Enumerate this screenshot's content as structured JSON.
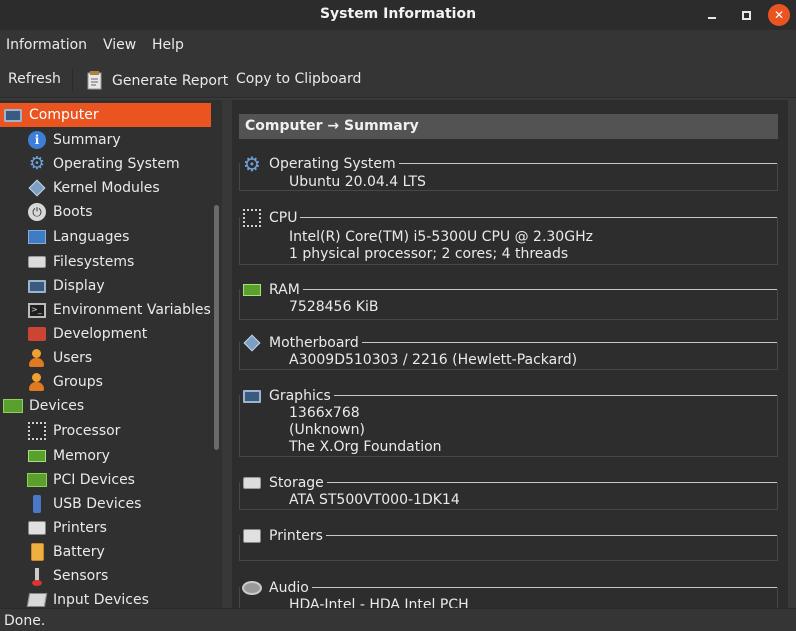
{
  "window": {
    "title": "System Information"
  },
  "menu": {
    "items": [
      "Information",
      "View",
      "Help"
    ]
  },
  "toolbar": {
    "refresh": "Refresh",
    "generate_report": "Generate Report",
    "copy": "Copy to Clipboard"
  },
  "sidebar": {
    "items": [
      {
        "label": "Computer",
        "icon": "monitor-icon"
      },
      {
        "label": "Summary",
        "icon": "info-icon"
      },
      {
        "label": "Operating System",
        "icon": "gear-icon"
      },
      {
        "label": "Kernel Modules",
        "icon": "module-icon"
      },
      {
        "label": "Boots",
        "icon": "power-icon"
      },
      {
        "label": "Languages",
        "icon": "flag-icon"
      },
      {
        "label": "Filesystems",
        "icon": "disk-icon"
      },
      {
        "label": "Display",
        "icon": "display-icon"
      },
      {
        "label": "Environment Variables",
        "icon": "terminal-icon"
      },
      {
        "label": "Development",
        "icon": "development-icon"
      },
      {
        "label": "Users",
        "icon": "user-icon"
      },
      {
        "label": "Groups",
        "icon": "group-icon"
      },
      {
        "label": "Devices",
        "icon": "chip-icon"
      },
      {
        "label": "Processor",
        "icon": "cpu-icon"
      },
      {
        "label": "Memory",
        "icon": "ram-icon"
      },
      {
        "label": "PCI Devices",
        "icon": "pci-icon"
      },
      {
        "label": "USB Devices",
        "icon": "usb-icon"
      },
      {
        "label": "Printers",
        "icon": "printer-icon"
      },
      {
        "label": "Battery",
        "icon": "battery-icon"
      },
      {
        "label": "Sensors",
        "icon": "sensor-icon"
      },
      {
        "label": "Input Devices",
        "icon": "input-device-icon"
      }
    ]
  },
  "content": {
    "header": "Computer → Summary",
    "sections": [
      {
        "title": "Operating System",
        "values": [
          "Ubuntu 20.04.4 LTS"
        ]
      },
      {
        "title": "CPU",
        "values": [
          "Intel(R) Core(TM) i5-5300U CPU @ 2.30GHz",
          "1 physical processor; 2 cores; 4 threads"
        ]
      },
      {
        "title": "RAM",
        "values": [
          "7528456 KiB"
        ]
      },
      {
        "title": "Motherboard",
        "values": [
          "A3009D510303 / 2216 (Hewlett-Packard)"
        ]
      },
      {
        "title": "Graphics",
        "values": [
          "1366x768",
          "(Unknown)",
          "The X.Org Foundation"
        ]
      },
      {
        "title": "Storage",
        "values": [
          "ATA ST500VT000-1DK14"
        ]
      },
      {
        "title": "Printers",
        "values": []
      },
      {
        "title": "Audio",
        "values": [
          "HDA-Intel - HDA Intel PCH"
        ]
      }
    ]
  },
  "status": {
    "text": "Done."
  }
}
